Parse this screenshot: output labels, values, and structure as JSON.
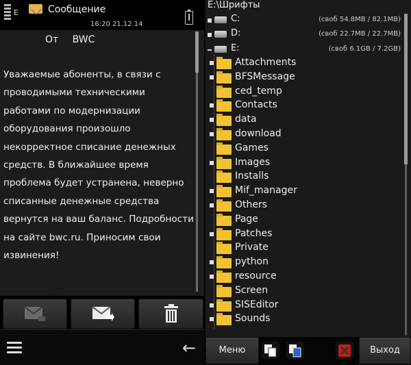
{
  "status": {
    "network_label": "E",
    "title": "Сообщение",
    "time": "16:20 21.12.14"
  },
  "message": {
    "from_label": "От",
    "sender": "BWC",
    "body": "Уважаемые абоненты, в связи с проводимыми техническими работами по модернизации оборудования произошло некорректное списание денежных средств. В ближайшее время проблема будет устранена, неверно списанные денежные средства вернутся на ваш баланс. Подробности на сайте bwc.ru.  Приносим свои извинения!"
  },
  "message_actions": {
    "reply_icon": "mail-reply-icon",
    "forward_icon": "mail-forward-icon",
    "delete_icon": "trash-icon"
  },
  "left_bar": {
    "menu_icon": "hamburger-icon",
    "back_icon": "back-arrow-icon"
  },
  "file_manager": {
    "path": "E:\\Шрифты",
    "drives": [
      {
        "name": "C:",
        "info": "(своб 54.8MB / 82.1MB)"
      },
      {
        "name": "D:",
        "info": "(своб 22.7MB / 22.7MB)"
      },
      {
        "name": "E:",
        "info": "(своб 6.1GB / 7.2GB)"
      }
    ],
    "folders": [
      {
        "name": "Attachments",
        "expandable": true
      },
      {
        "name": "BFSMessage",
        "expandable": true
      },
      {
        "name": "ced_temp",
        "expandable": false
      },
      {
        "name": "Contacts",
        "expandable": true
      },
      {
        "name": "data",
        "expandable": true
      },
      {
        "name": "download",
        "expandable": true
      },
      {
        "name": "Games",
        "expandable": false
      },
      {
        "name": "Images",
        "expandable": true
      },
      {
        "name": "Installs",
        "expandable": false
      },
      {
        "name": "Mif_manager",
        "expandable": true
      },
      {
        "name": "Others",
        "expandable": true
      },
      {
        "name": "Page",
        "expandable": false
      },
      {
        "name": "Patches",
        "expandable": true
      },
      {
        "name": "Private",
        "expandable": false
      },
      {
        "name": "python",
        "expandable": true
      },
      {
        "name": "resource",
        "expandable": true
      },
      {
        "name": "Screen",
        "expandable": false
      },
      {
        "name": "SISEditor",
        "expandable": true
      },
      {
        "name": "Sounds",
        "expandable": true
      }
    ]
  },
  "softkeys": {
    "left": "Меню",
    "right": "Выход"
  },
  "colors": {
    "folder": "#f1c232",
    "background": "#1b1b1b"
  }
}
